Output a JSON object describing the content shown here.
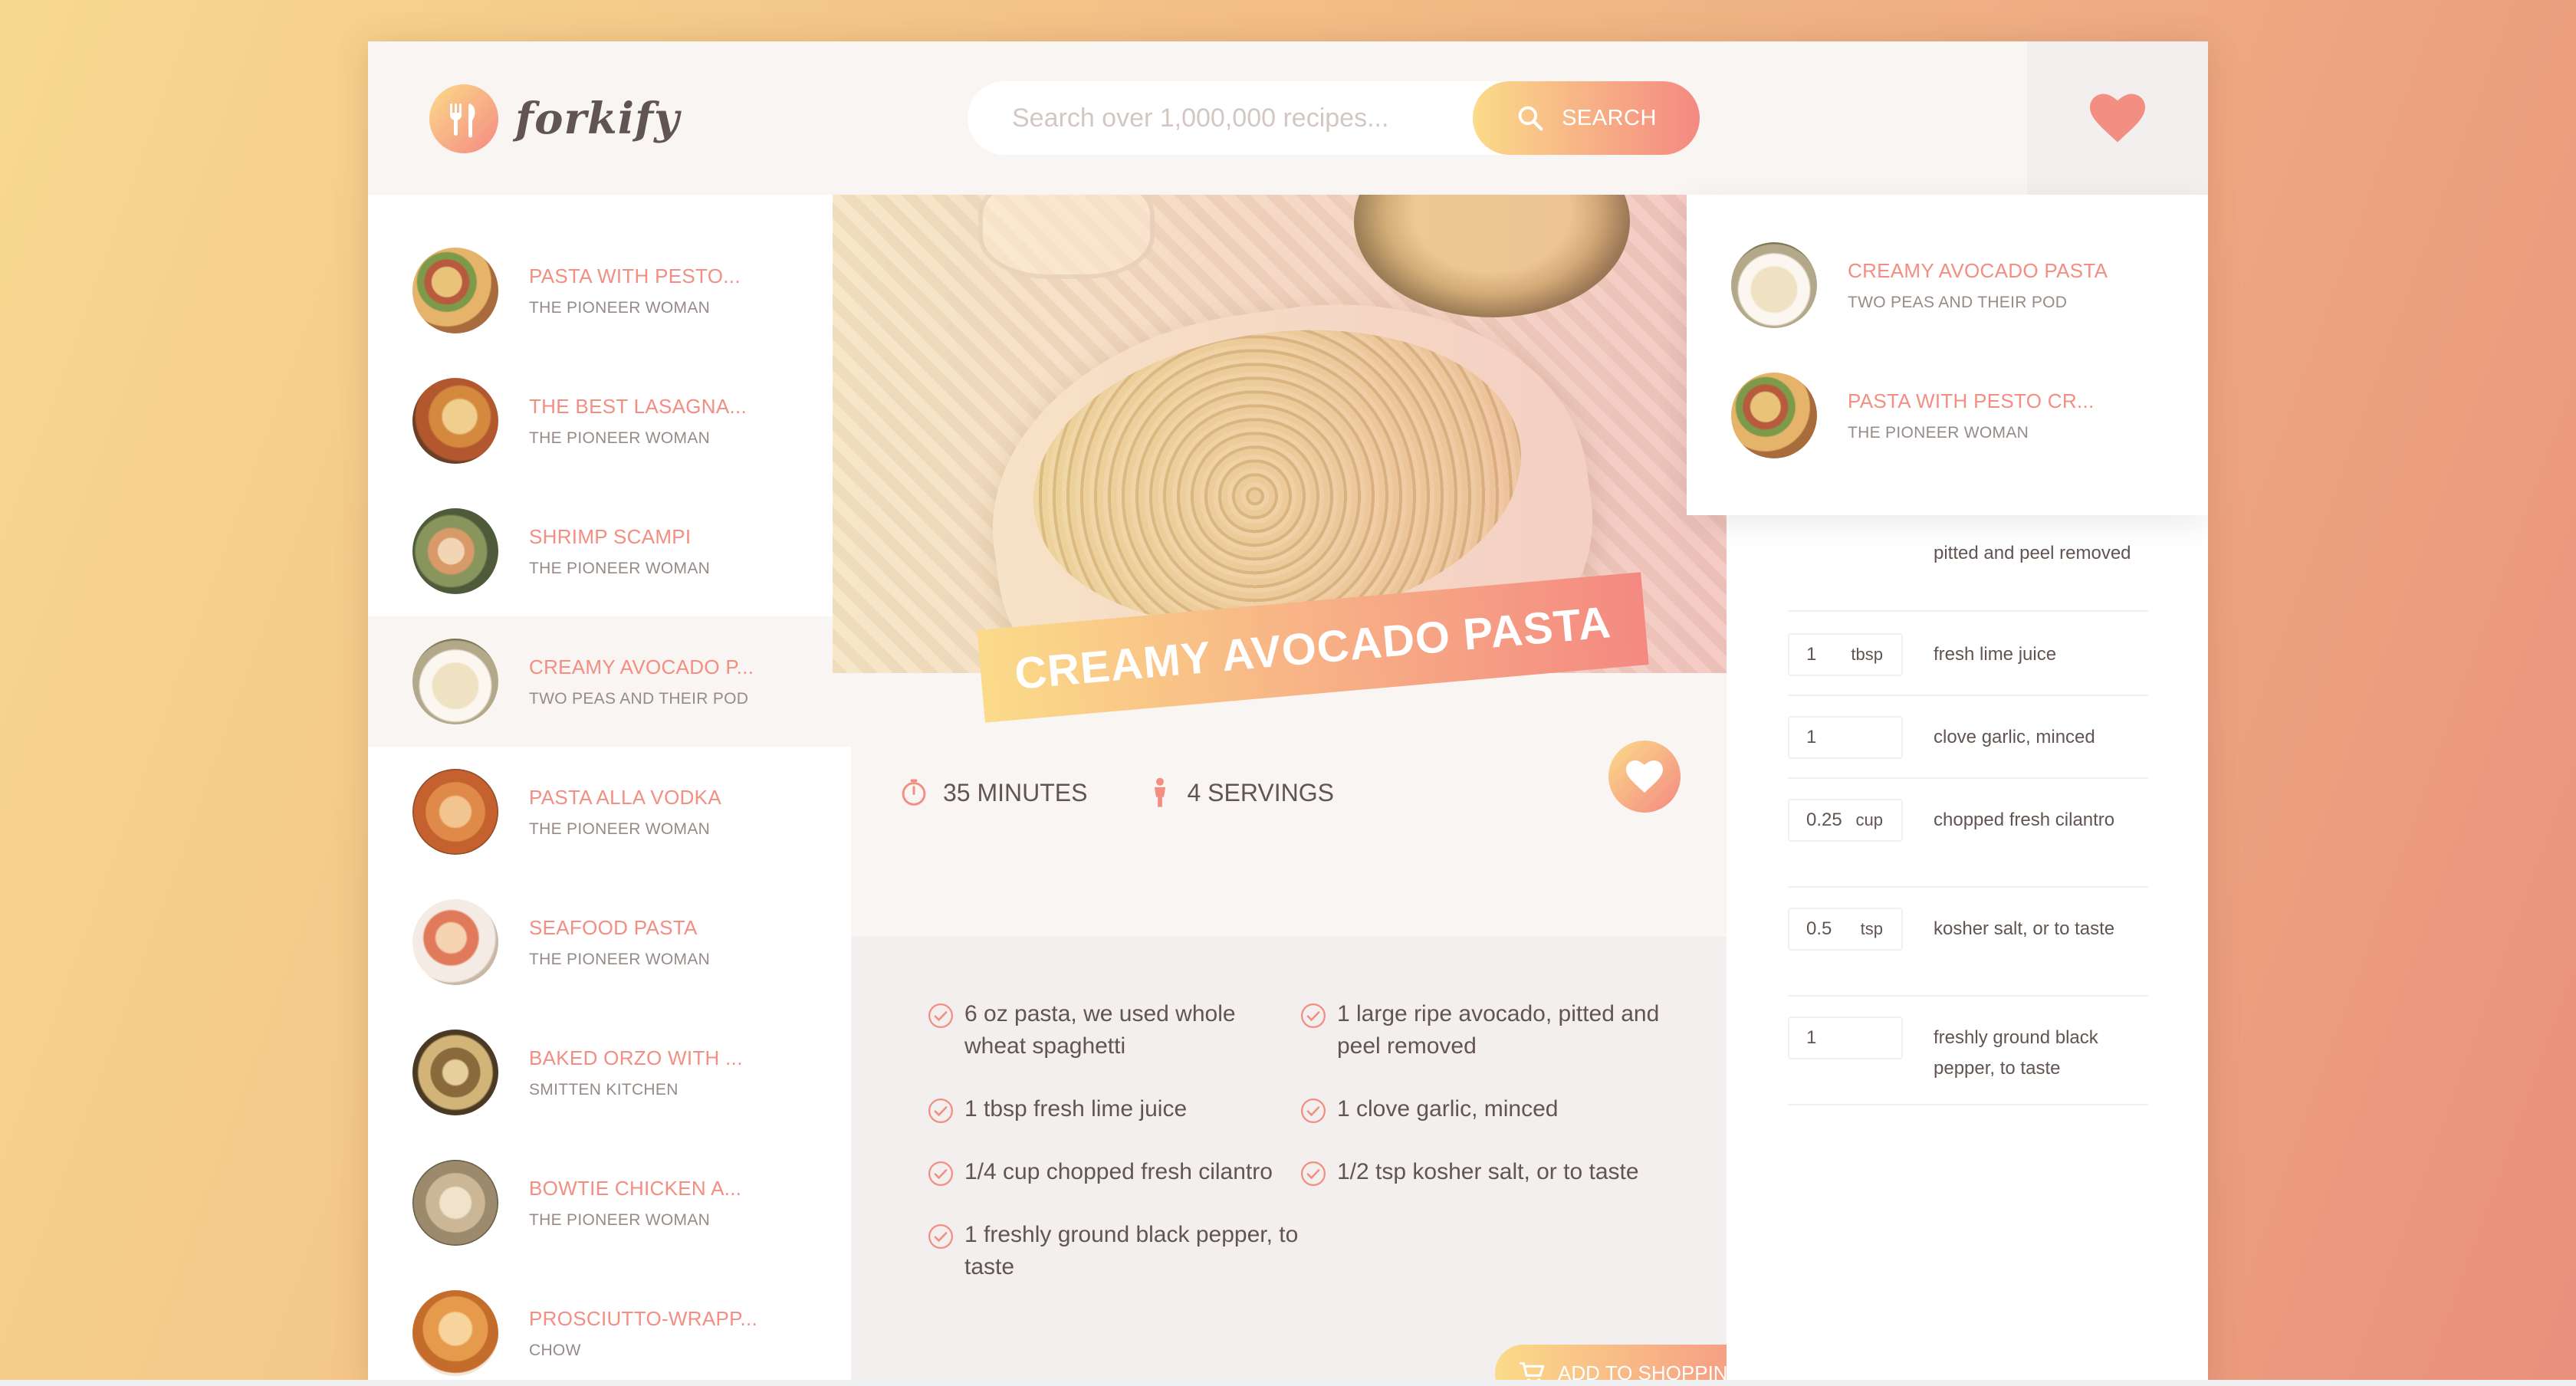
{
  "brand": {
    "name": "forkify",
    "accent_from": "#fbdb89",
    "accent_to": "#f48982",
    "text_color": "#615551"
  },
  "search": {
    "placeholder": "Search over 1,000,000 recipes...",
    "button_label": "SEARCH",
    "icon": "search-icon"
  },
  "likes_icon": "heart-icon",
  "results": [
    {
      "name": "PASTA WITH PESTO...",
      "author": "THE PIONEER WOMAN"
    },
    {
      "name": "THE BEST LASAGNA...",
      "author": "THE PIONEER WOMAN"
    },
    {
      "name": "SHRIMP SCAMPI",
      "author": "THE PIONEER WOMAN"
    },
    {
      "name": "CREAMY AVOCADO P...",
      "author": "TWO PEAS AND THEIR POD"
    },
    {
      "name": "PASTA ALLA VODKA",
      "author": "THE PIONEER WOMAN"
    },
    {
      "name": "SEAFOOD PASTA",
      "author": "THE PIONEER WOMAN"
    },
    {
      "name": "BAKED ORZO WITH ...",
      "author": "SMITTEN KITCHEN"
    },
    {
      "name": "BOWTIE CHICKEN A...",
      "author": "THE PIONEER WOMAN"
    },
    {
      "name": "PROSCIUTTO-WRAPP...",
      "author": "CHOW"
    }
  ],
  "recipe": {
    "title": "CREAMY AVOCADO PASTA",
    "time": "35",
    "time_unit": "MINUTES",
    "servings": "4",
    "servings_unit": "SERVINGS",
    "ingredients": [
      "6 oz pasta, we used whole wheat spaghetti",
      "1 large ripe avocado, pitted and peel removed",
      "1 tbsp fresh lime juice",
      "1 clove garlic, minced",
      "1/4 cup chopped fresh cilantro",
      "1/2 tsp kosher salt, or to taste",
      "1 freshly ground black pepper, to taste"
    ],
    "shopping_button": "ADD TO SHOPPING LIST"
  },
  "shopping_list": [
    {
      "count": "",
      "unit": "",
      "desc": "pitted and peel removed"
    },
    {
      "count": "1",
      "unit": "tbsp",
      "desc": "fresh lime juice"
    },
    {
      "count": "1",
      "unit": "",
      "desc": "clove garlic, minced"
    },
    {
      "count": "0.25",
      "unit": "cup",
      "desc": "chopped fresh cilantro"
    },
    {
      "count": "0.5",
      "unit": "tsp",
      "desc": "kosher salt, or to taste"
    },
    {
      "count": "1",
      "unit": "",
      "desc": "freshly ground black pepper, to taste"
    }
  ],
  "likes": [
    {
      "name": "CREAMY AVOCADO PASTA",
      "author": "TWO PEAS AND THEIR POD"
    },
    {
      "name": "PASTA WITH PESTO CR...",
      "author": "THE PIONEER WOMAN"
    }
  ]
}
